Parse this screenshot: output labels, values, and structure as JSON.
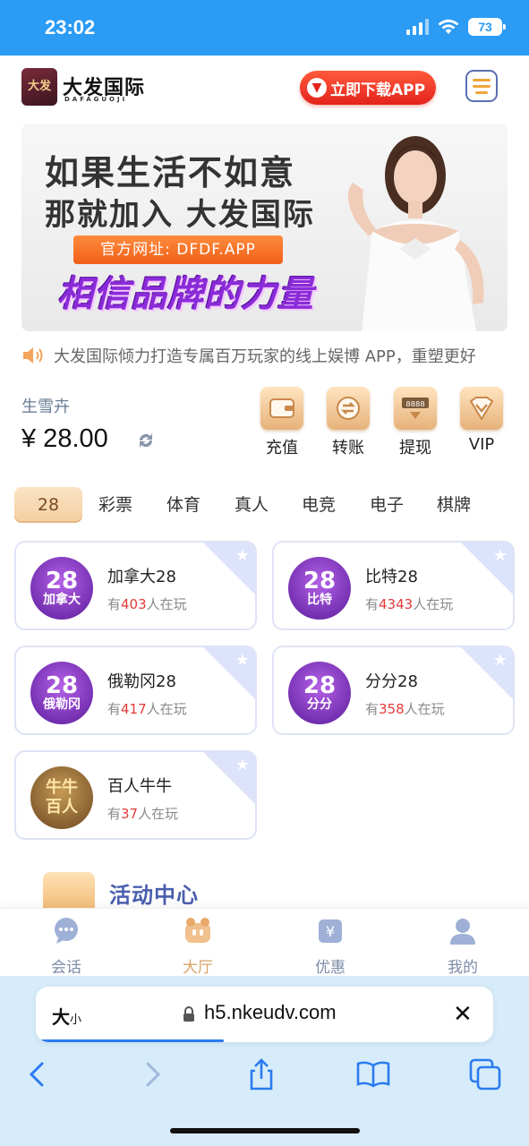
{
  "status_bar": {
    "time": "23:02",
    "battery": "73"
  },
  "header": {
    "logo_text": "大发",
    "brand_name": "大发国际",
    "brand_sub": "DAFAGUOJI",
    "download_label": "立即下载APP"
  },
  "banner": {
    "line1": "如果生活不如意",
    "line2": "那就加入 大发国际",
    "url": "官方网址: DFDF.APP",
    "slogan": "相信品牌的力量"
  },
  "marquee": {
    "text": "大发国际倾力打造专属百万玩家的线上娱博 APP，重塑更好"
  },
  "account": {
    "username": "生雪卉",
    "balance": "¥ 28.00"
  },
  "wallet_actions": [
    {
      "label": "充值",
      "icon": "wallet-icon"
    },
    {
      "label": "转账",
      "icon": "transfer-icon"
    },
    {
      "label": "提现",
      "icon": "withdraw-icon"
    },
    {
      "label": "VIP",
      "icon": "vip-icon"
    }
  ],
  "tabs": [
    "28",
    "彩票",
    "体育",
    "真人",
    "电竞",
    "电子",
    "棋牌"
  ],
  "games": [
    {
      "title": "加拿大28",
      "thumb_num": "28",
      "thumb_name": "加拿大",
      "prefix": "有",
      "count": "403",
      "suffix": "人在玩"
    },
    {
      "title": "比特28",
      "thumb_num": "28",
      "thumb_name": "比特",
      "prefix": "有",
      "count": "4343",
      "suffix": "人在玩"
    },
    {
      "title": "俄勒冈28",
      "thumb_num": "28",
      "thumb_name": "俄勒冈",
      "prefix": "有",
      "count": "417",
      "suffix": "人在玩"
    },
    {
      "title": "分分28",
      "thumb_num": "28",
      "thumb_name": "分分",
      "prefix": "有",
      "count": "358",
      "suffix": "人在玩"
    },
    {
      "title": "百人牛牛",
      "thumb_num": "牛牛",
      "thumb_name": "百人",
      "prefix": "有",
      "count": "37",
      "suffix": "人在玩"
    }
  ],
  "activity": {
    "title": "活动中心"
  },
  "bottom_nav": [
    {
      "label": "会话",
      "icon": "chat-icon"
    },
    {
      "label": "大厅",
      "icon": "lobby-icon",
      "active": true
    },
    {
      "label": "优惠",
      "icon": "promo-icon"
    },
    {
      "label": "我的",
      "icon": "profile-icon"
    }
  ],
  "browser": {
    "text_size_big": "大",
    "text_size_small": "小",
    "url": "h5.nkeudv.com",
    "load_progress": 0.4
  },
  "colors": {
    "status_bar": "#2b9bf4",
    "accent_red": "#e3231b",
    "count_red": "#e23a3a",
    "nav_active": "#d8a46a"
  }
}
